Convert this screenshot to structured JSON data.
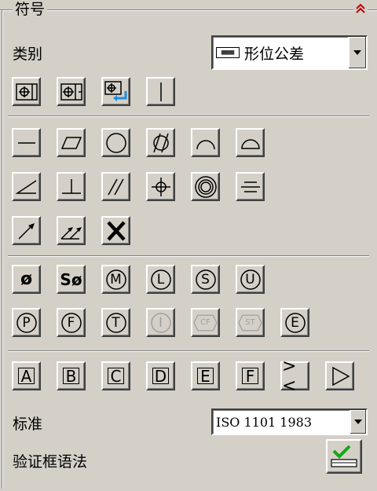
{
  "panel": {
    "title": "符号",
    "collapse_icon": "double-chevron-up-icon"
  },
  "category": {
    "label": "类别",
    "selected": "形位公差",
    "icon": "abc-dropdown-icon"
  },
  "standard": {
    "label": "标准",
    "selected": "ISO 1101 1983"
  },
  "verify": {
    "label": "验证框语法",
    "icon": "checkmark-icon"
  },
  "frame_buttons": [
    "frame-position-icon",
    "frame-position-datum-icon",
    "frame-insert-icon",
    "frame-divider-icon"
  ],
  "tolerance_buttons": [
    "straightness-icon",
    "flatness-icon",
    "circularity-icon",
    "cylindricity-icon",
    "profile-line-icon",
    "profile-surface-icon",
    "angularity-icon",
    "perpendicularity-icon",
    "parallelism-icon",
    "position-icon",
    "concentricity-icon",
    "symmetry-icon",
    "circular-runout-icon",
    "total-runout-icon",
    "delete-icon"
  ],
  "modifiers": {
    "row1": [
      "ø",
      "Sø",
      "M",
      "L",
      "S",
      "U"
    ],
    "row2": [
      "P",
      "F",
      "T",
      "I",
      "CF",
      "ST",
      "E"
    ]
  },
  "datums": [
    "A",
    "B",
    "C",
    "D",
    "E",
    "F",
    "><",
    "▷"
  ]
}
